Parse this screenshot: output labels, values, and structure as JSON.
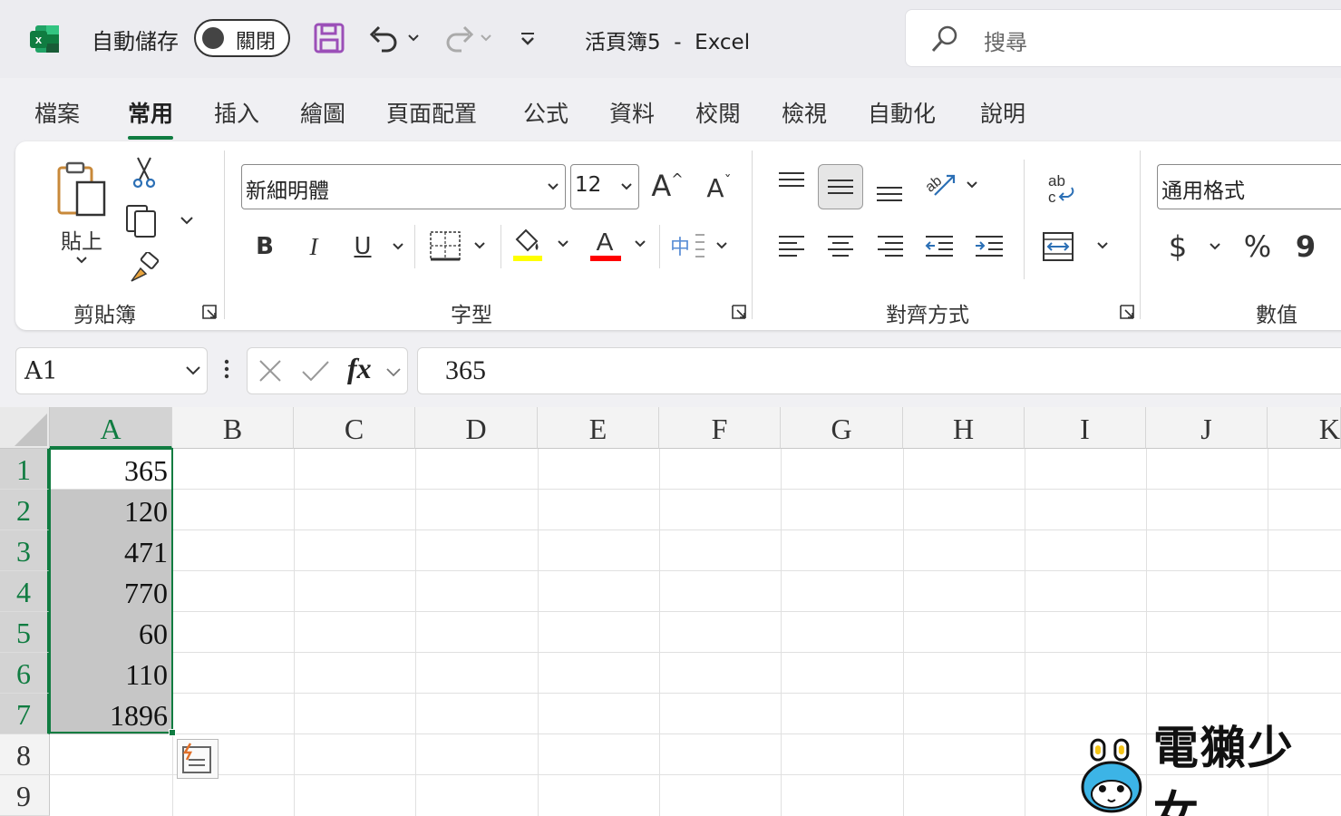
{
  "title_bar": {
    "autosave_label": "自動儲存",
    "autosave_state": "關閉",
    "document_title": "活頁簿5  -  Excel",
    "search_placeholder": "搜尋"
  },
  "tabs": [
    "檔案",
    "常用",
    "插入",
    "繪圖",
    "頁面配置",
    "公式",
    "資料",
    "校閱",
    "檢視",
    "自動化",
    "說明"
  ],
  "active_tab": "常用",
  "ribbon": {
    "clipboard": {
      "label": "剪貼簿",
      "paste_label": "貼上"
    },
    "font": {
      "label": "字型",
      "font_name": "新細明體",
      "font_size": "12",
      "bold": "B",
      "italic": "I",
      "underline": "U",
      "grow": "A",
      "shrink": "A",
      "font_color_letter": "A",
      "phonetic": "中"
    },
    "alignment": {
      "label": "對齊方式",
      "wrap_glyph": "ab"
    },
    "number": {
      "label": "數值",
      "format": "通用格式",
      "currency": "$",
      "percent": "%",
      "comma": "9"
    }
  },
  "formula_bar": {
    "name_box": "A1",
    "fx": "fx",
    "formula": "365"
  },
  "sheet": {
    "columns": [
      "A",
      "B",
      "C",
      "D",
      "E",
      "F",
      "G",
      "H",
      "I",
      "J",
      "K"
    ],
    "rows": [
      "1",
      "2",
      "3",
      "4",
      "5",
      "6",
      "7",
      "8",
      "9"
    ],
    "column_a_values": [
      "365",
      "120",
      "471",
      "770",
      "60",
      "110",
      "1896"
    ]
  },
  "watermark": "電獺少女",
  "colors": {
    "excel_green": "#107c41",
    "highlight_yellow": "#ffff00",
    "font_red": "#ff0000",
    "selection_gray": "#c6c6c6",
    "save_purple": "#9b4fb8"
  }
}
